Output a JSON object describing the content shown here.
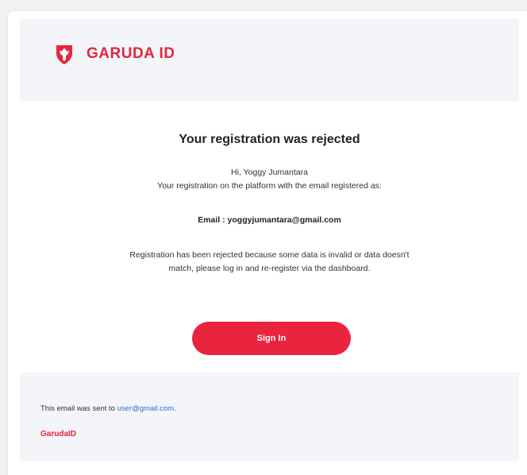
{
  "brand": {
    "logo_text": "GARUDA ID",
    "accent_color": "#e3263f",
    "logo_icon": "garuda-shield-icon"
  },
  "main": {
    "title": "Your registration was rejected",
    "greeting": "Hi, Yoggy Jumantara",
    "intro": "Your registration on the platform with the email registered as:",
    "email_line": "Email : yoggyjumantara@gmail.com",
    "reason": "Registration has been rejected because some data is invalid or data doesn't match, please log in and re-register via the dashboard.",
    "button_label": "Sign In"
  },
  "footer": {
    "sent_prefix": "This email was sent to ",
    "sent_email": "user@gmail.com",
    "sent_suffix": ".",
    "brand": "GarudaID"
  }
}
